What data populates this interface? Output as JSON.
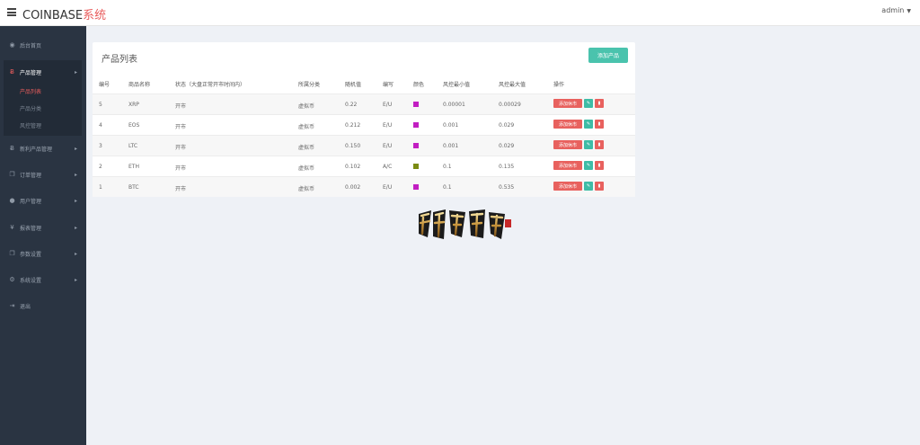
{
  "brand": {
    "main": "COINBASE",
    "accent": "系统"
  },
  "user": {
    "name": "admin"
  },
  "sidebar": {
    "items": [
      {
        "label": "后台首页",
        "icon": "dashboard-icon"
      },
      {
        "label": "产品管理",
        "icon": "bitcoin-icon"
      },
      {
        "label": "新利产品管理",
        "icon": "bitcoin-icon"
      },
      {
        "label": "订单管理",
        "icon": "copy-icon"
      },
      {
        "label": "用户管理",
        "icon": "user-icon"
      },
      {
        "label": "报表管理",
        "icon": "yen-icon"
      },
      {
        "label": "参数设置",
        "icon": "copy-icon"
      },
      {
        "label": "系统设置",
        "icon": "cogs-icon"
      },
      {
        "label": "退出",
        "icon": "sign-out-icon"
      }
    ],
    "submenu": [
      "产品列表",
      "产品分类",
      "风控管理"
    ]
  },
  "main": {
    "title": "产品列表",
    "add_button": "添加产品",
    "headers": [
      "编号",
      "商品名称",
      "状态（大盘正常开市时间内）",
      "所属分类",
      "随机值",
      "编写",
      "颜色",
      "风控最小值",
      "风控最大值",
      "操作"
    ],
    "rows": [
      {
        "id": "5",
        "name": "XRP",
        "status": "开市",
        "category": "虚拟币",
        "random": "0.22",
        "code": "E/U",
        "color": "#c21ec2",
        "min": "0.00001",
        "max": "0.00029"
      },
      {
        "id": "4",
        "name": "EOS",
        "status": "开市",
        "category": "虚拟币",
        "random": "0.212",
        "code": "E/U",
        "color": "#c21ec2",
        "min": "0.001",
        "max": "0.029"
      },
      {
        "id": "3",
        "name": "LTC",
        "status": "开市",
        "category": "虚拟币",
        "random": "0.150",
        "code": "E/U",
        "color": "#c21ec2",
        "min": "0.001",
        "max": "0.029"
      },
      {
        "id": "2",
        "name": "ETH",
        "status": "开市",
        "category": "虚拟币",
        "random": "0.102",
        "code": "A/C",
        "color": "#7a8b12",
        "min": "0.1",
        "max": "0.135"
      },
      {
        "id": "1",
        "name": "BTC",
        "status": "开市",
        "category": "虚拟币",
        "random": "0.002",
        "code": "E/U",
        "color": "#c21ec2",
        "min": "0.1",
        "max": "0.535"
      }
    ],
    "row_actions": {
      "market_button": "添加休市",
      "edit_icon": "pencil-icon",
      "delete_icon": "trash-icon"
    }
  },
  "logo": {
    "text": "南亚科技"
  },
  "colors": {
    "accent": "#e85c5c",
    "teal": "#4ac3ad",
    "sidebar": "#2a3442",
    "background": "#eef1f6"
  }
}
